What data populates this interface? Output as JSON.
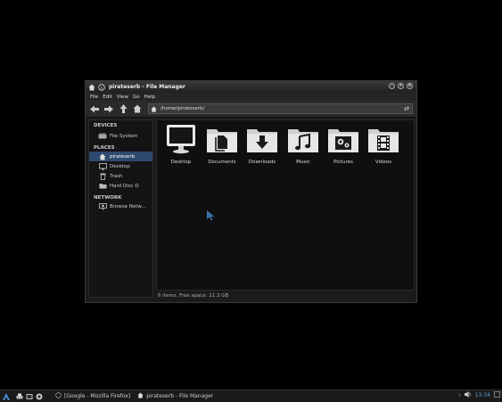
{
  "window": {
    "title": "pirateserb - File Manager",
    "menu": [
      "File",
      "Edit",
      "View",
      "Go",
      "Help"
    ],
    "location_path": "/home/pirateserb/"
  },
  "sidebar": {
    "devices_title": "DEVICES",
    "devices": [
      {
        "label": "File System",
        "icon": "drive-icon"
      }
    ],
    "places_title": "PLACES",
    "places": [
      {
        "label": "pirateserb",
        "icon": "home-icon",
        "active": true
      },
      {
        "label": "Desktop",
        "icon": "desktop-icon"
      },
      {
        "label": "Trash",
        "icon": "trash-icon"
      },
      {
        "label": "Hard Disc D",
        "icon": "disk-icon"
      }
    ],
    "network_title": "NETWORK",
    "network": [
      {
        "label": "Browse Netw...",
        "icon": "network-icon"
      }
    ]
  },
  "folders": [
    {
      "label": "Desktop",
      "icon": "monitor-icon"
    },
    {
      "label": "Documents",
      "icon": "documents-icon"
    },
    {
      "label": "Downloads",
      "icon": "download-icon"
    },
    {
      "label": "Music",
      "icon": "music-icon"
    },
    {
      "label": "Pictures",
      "icon": "pictures-icon"
    },
    {
      "label": "Videos",
      "icon": "videos-icon"
    }
  ],
  "status": "6 items, Free space: 11.3 GB",
  "taskbar": {
    "tasks": [
      {
        "label": "[Google - Mozilla Firefox]"
      },
      {
        "label": "pirateserb - File Manager"
      }
    ],
    "clock": "13:34"
  },
  "colors": {
    "accent": "#2d4a6e",
    "clock": "#5aa0e6"
  }
}
